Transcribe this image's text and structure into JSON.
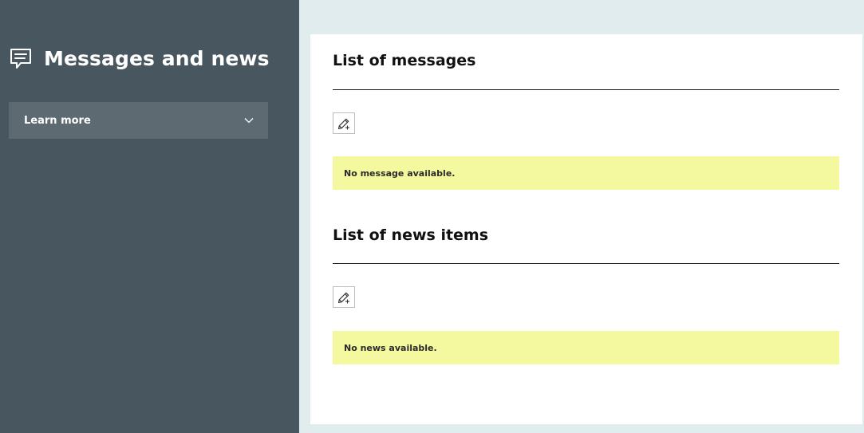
{
  "sidebar": {
    "title": "Messages and news",
    "title_icon": "chat-bubble-icon",
    "learn_more": {
      "label": "Learn more",
      "icon": "chevron-down-icon"
    }
  },
  "messages": {
    "title": "List of messages",
    "add_icon": "pencil-plus-icon",
    "empty_text": "No message available."
  },
  "news": {
    "title": "List of news items",
    "add_icon": "pencil-plus-icon",
    "empty_text": "No news available."
  },
  "colors": {
    "sidebar_bg": "#48565f",
    "accordion_bg": "#5d6a72",
    "page_bg": "#e1ecee",
    "notice_bg": "#f4f99f"
  }
}
